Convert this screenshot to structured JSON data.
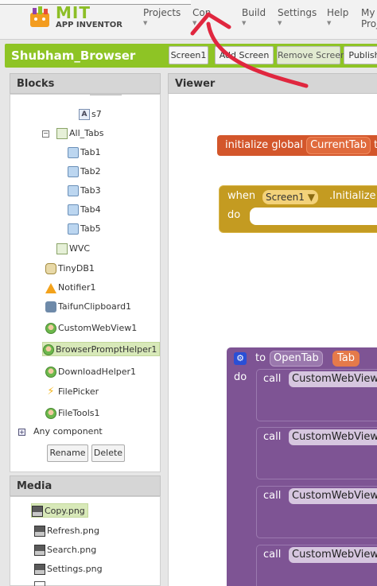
{
  "logo": {
    "mit": "MIT",
    "sub": "APP INVENTOR"
  },
  "top_menu": [
    "Projects",
    "Connect",
    "Build",
    "Settings",
    "Help",
    "My Projects"
  ],
  "top_menu_visible": [
    "Projects",
    "Con",
    "Build",
    "Settings",
    "Help",
    "My Proj"
  ],
  "project": {
    "title": "Shubham_Browser"
  },
  "screen_buttons": {
    "screen": "Screen1",
    "add": "Add Screen",
    "remove": "Remove Screen",
    "publish": "Publish"
  },
  "blocks": {
    "header": "Blocks",
    "items": {
      "s7": "s7",
      "all_tabs": "All_Tabs",
      "tab1": "Tab1",
      "tab2": "Tab2",
      "tab3": "Tab3",
      "tab4": "Tab4",
      "tab5": "Tab5",
      "wvc": "WVC",
      "tinydb": "TinyDB1",
      "notifier": "Notifier1",
      "clipboard": "TaifunClipboard1",
      "customwebview": "CustomWebView1",
      "promptHelper": "BrowserPromptHelper1",
      "downloadHelper": "DownloadHelper1",
      "filepicker": "FilePicker",
      "filetools": "FileTools1",
      "any_component": "Any component"
    },
    "rename": "Rename",
    "delete": "Delete"
  },
  "media": {
    "header": "Media",
    "files": [
      "Copy.png",
      "Refresh.png",
      "Search.png",
      "Settings.png"
    ]
  },
  "viewer": {
    "header": "Viewer",
    "global_block": {
      "label": "initialize global",
      "name": "CurrentTab",
      "tail": "t"
    },
    "when_block": {
      "when": "when",
      "screen": "Screen1",
      "event": ".Initialize",
      "do": "do"
    },
    "proc_block": {
      "to": "to",
      "name": "OpenTab",
      "param": "Tab",
      "do": "do",
      "call": "call",
      "callee": "CustomWebView"
    }
  },
  "colors": {
    "green_bar": "#8ec425",
    "global_block": "#d3562b",
    "event_block": "#c49b21",
    "proc_block": "#7e5494",
    "annotation": "#e0273f"
  }
}
